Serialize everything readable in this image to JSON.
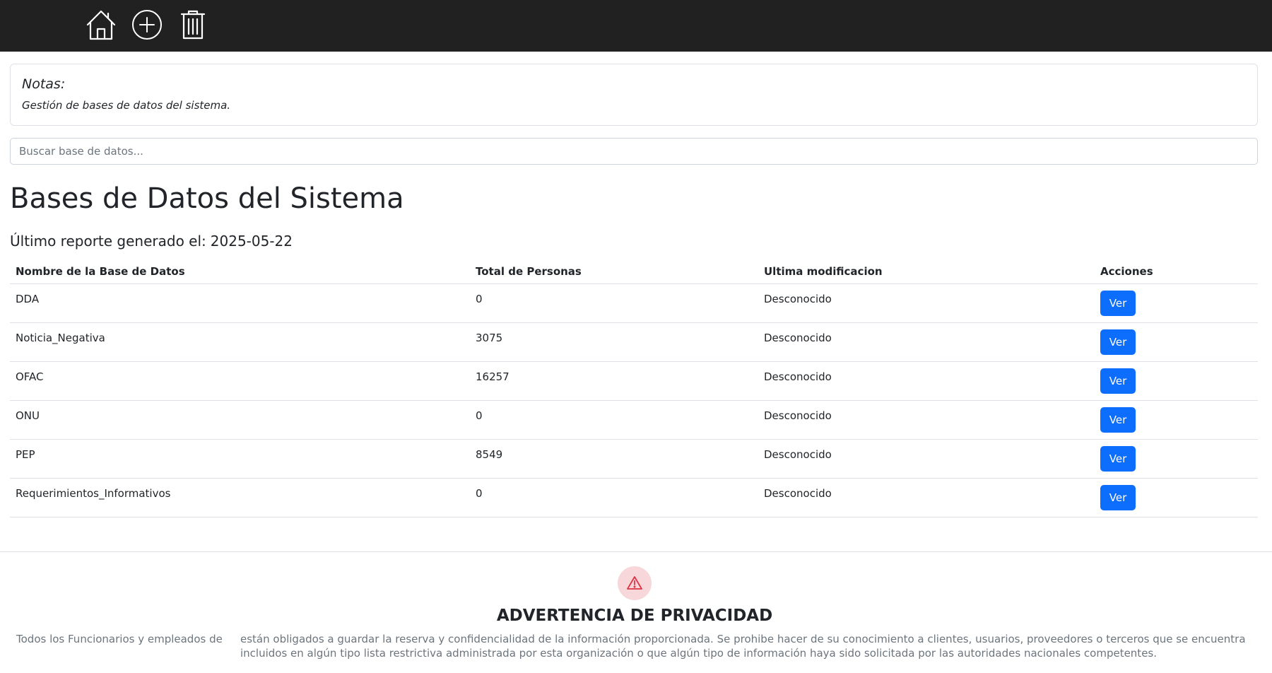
{
  "nav": {
    "icons": [
      "home-icon",
      "add-circle-icon",
      "trash-icon"
    ]
  },
  "notes": {
    "title": "Notas:",
    "text": "Gestión de bases de datos del sistema."
  },
  "search": {
    "placeholder": "Buscar base de datos..."
  },
  "page": {
    "title": "Bases de Datos del Sistema",
    "report_label": "Último reporte generado el:",
    "report_date": "2025-05-22"
  },
  "table": {
    "headers": [
      "Nombre de la Base de Datos",
      "Total de Personas",
      "Ultima modificacion",
      "Acciones"
    ],
    "rows": [
      {
        "name": "DDA",
        "total": "0",
        "modified": "Desconocido",
        "action": "Ver"
      },
      {
        "name": "Noticia_Negativa",
        "total": "3075",
        "modified": "Desconocido",
        "action": "Ver"
      },
      {
        "name": "OFAC",
        "total": "16257",
        "modified": "Desconocido",
        "action": "Ver"
      },
      {
        "name": "ONU",
        "total": "0",
        "modified": "Desconocido",
        "action": "Ver"
      },
      {
        "name": "PEP",
        "total": "8549",
        "modified": "Desconocido",
        "action": "Ver"
      },
      {
        "name": "Requerimientos_Informativos",
        "total": "0",
        "modified": "Desconocido",
        "action": "Ver"
      }
    ]
  },
  "footer": {
    "title": "ADVERTENCIA DE PRIVACIDAD",
    "left_text": "Todos los Funcionarios y empleados de",
    "right_text": "están obligados a guardar la reserva y confidencialidad de la información proporcionada. Se prohibe hacer de su conocimiento a clientes, usuarios, proveedores o terceros que se encuentra incluidos en algún tipo lista restrictiva administrada por esta organización o que algún tipo de información haya sido solicitada por las autoridades nacionales competentes."
  },
  "colors": {
    "topbar": "#212121",
    "primary": "#0d6efd",
    "warning_bg": "#f8d7da",
    "warning_icon": "#dc3545"
  }
}
